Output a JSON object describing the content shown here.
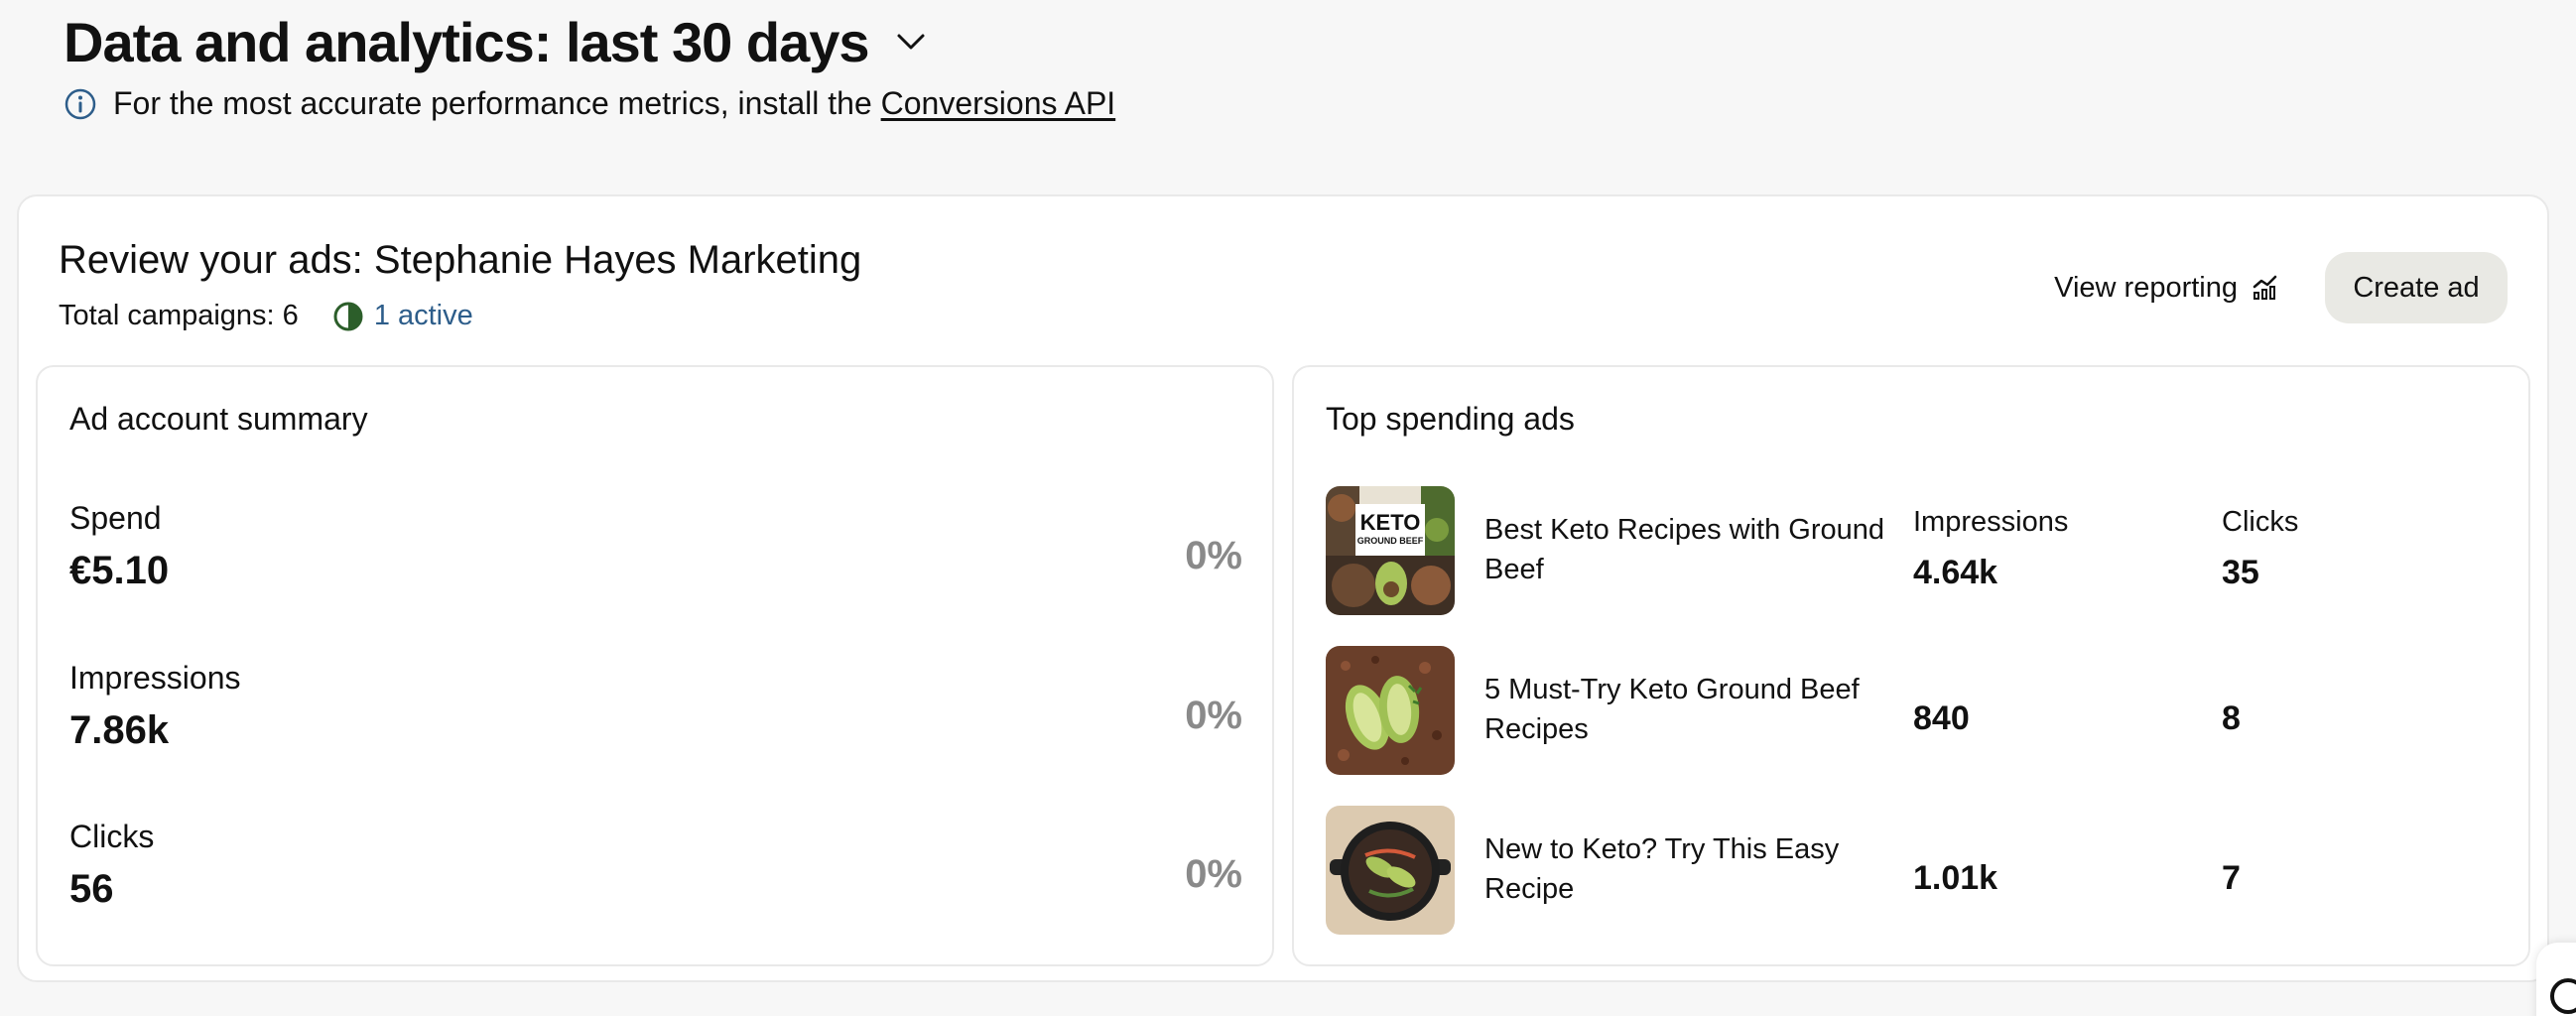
{
  "header": {
    "title": "Data and analytics: last 30 days",
    "chevron_icon": "chevron-down-icon",
    "info_icon": "info-icon",
    "info_text": "For the most accurate performance metrics, install the ",
    "info_link": "Conversions API"
  },
  "review": {
    "title": "Review your ads: Stephanie Hayes Marketing",
    "total_campaigns": "Total campaigns: 6",
    "active_icon": "half-circle-status-icon",
    "active_text": "1 active",
    "view_reporting": "View reporting",
    "view_reporting_icon": "analytics-icon",
    "create_ad": "Create ad"
  },
  "summary": {
    "title": "Ad account summary",
    "metrics": [
      {
        "label": "Spend",
        "value": "€5.10",
        "change": "0%"
      },
      {
        "label": "Impressions",
        "value": "7.86k",
        "change": "0%"
      },
      {
        "label": "Clicks",
        "value": "56",
        "change": "0%"
      }
    ]
  },
  "top_ads": {
    "title": "Top spending ads",
    "columns": {
      "impressions": "Impressions",
      "clicks": "Clicks"
    },
    "ads": [
      {
        "name": "Best Keto Recipes with Ground Beef",
        "impressions": "4.64k",
        "clicks": "35",
        "thumb_text_1": "KETO",
        "thumb_text_2": "GROUND BEEF"
      },
      {
        "name": "5 Must-Try Keto Ground Beef Recipes",
        "impressions": "840",
        "clicks": "8"
      },
      {
        "name": "New to Keto? Try This Easy Recipe",
        "impressions": "1.01k",
        "clicks": "7"
      }
    ]
  },
  "colors": {
    "background": "#f7f7f7",
    "card": "#ffffff",
    "active_text": "#2d5d8a",
    "muted_percent": "#8a8a8a",
    "create_button": "#e9e9e4"
  }
}
